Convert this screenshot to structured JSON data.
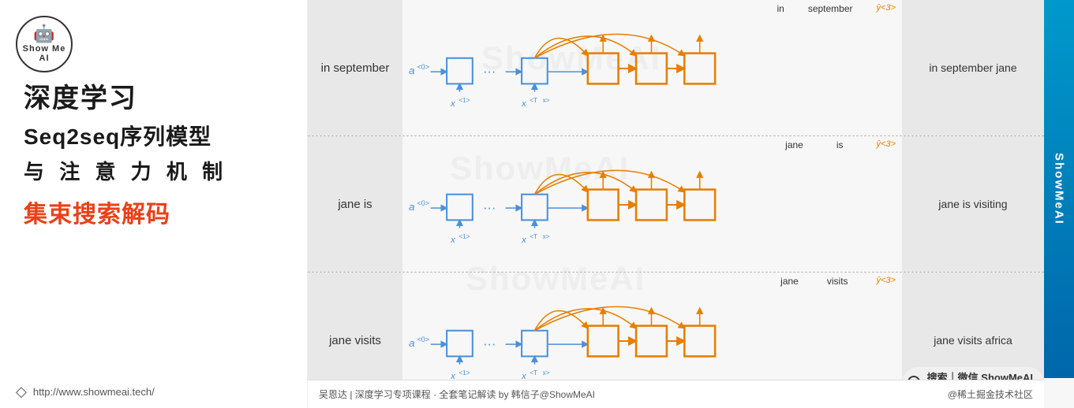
{
  "left": {
    "logo_text": "Show Me AI",
    "logo_icon": "🤖",
    "title1": "深度学习",
    "title2": "Seq2seq序列模型",
    "title3": "与 注 意 力 机 制",
    "highlight": "集束搜索解码",
    "link": "http://www.showmeai.tech/",
    "footer": "吴恩达 | 深度学习专项课程 · 全套笔记解读  by 韩信子@ShowMeAI"
  },
  "right": {
    "brand": "ShowMeAI",
    "watermarks": [
      "ShowMeAI",
      "ShowMeAI",
      "ShowMeAI"
    ],
    "rows": [
      {
        "input": "in september",
        "output": "in september jane",
        "top_words": "in  september",
        "yhat": "ŷ<3>"
      },
      {
        "input": "jane is",
        "output": "jane is visiting",
        "top_words": "jane   is",
        "yhat": "ŷ<3>"
      },
      {
        "input": "jane visits",
        "output": "jane visits africa",
        "top_words": "jane   visits",
        "yhat": "ŷ<3>"
      }
    ],
    "bottom_left": "吴恩达 | 深度学习专项课程 · 全套笔记解读  by 韩信子@ShowMeAI",
    "bottom_right": "@稀土掘金技术社区",
    "search_text": "搜索｜微信  ShowMeAI 研究中心"
  }
}
